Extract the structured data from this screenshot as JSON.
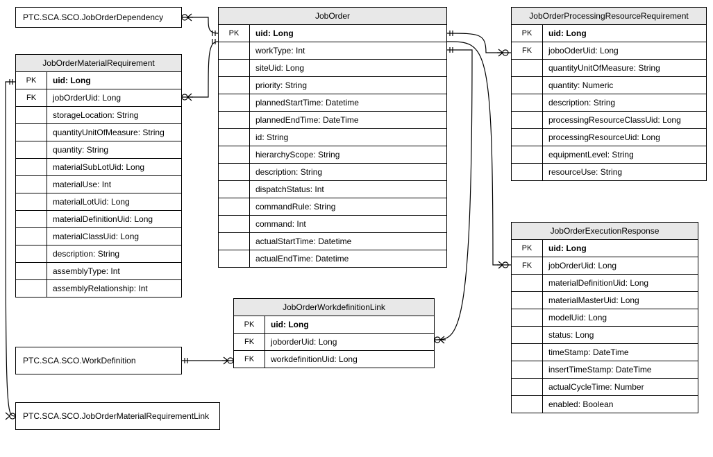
{
  "boxes": {
    "jobOrderDependency": "PTC.SCA.SCO.JobOrderDependency",
    "workDefinition": "PTC.SCA.SCO.WorkDefinition",
    "jobOrderMatReqLink": "PTC.SCA.SCO.JobOrderMaterialRequirementLink"
  },
  "entities": {
    "jobOrder": {
      "title": "JobOrder",
      "rows": [
        {
          "key": "PK",
          "field": "uid: Long",
          "bold": true
        },
        {
          "key": "",
          "field": "workType: Int"
        },
        {
          "key": "",
          "field": "siteUid: Long"
        },
        {
          "key": "",
          "field": "priority: String"
        },
        {
          "key": "",
          "field": "plannedStartTime: Datetime"
        },
        {
          "key": "",
          "field": "plannedEndTime: DateTime"
        },
        {
          "key": "",
          "field": "id: String"
        },
        {
          "key": "",
          "field": "hierarchyScope: String"
        },
        {
          "key": "",
          "field": "description: String"
        },
        {
          "key": "",
          "field": "dispatchStatus: Int"
        },
        {
          "key": "",
          "field": "commandRule: String"
        },
        {
          "key": "",
          "field": "command: Int"
        },
        {
          "key": "",
          "field": "actualStartTime: Datetime"
        },
        {
          "key": "",
          "field": "actualEndTime: Datetime"
        }
      ]
    },
    "matReq": {
      "title": "JobOrderMaterialRequirement",
      "rows": [
        {
          "key": "PK",
          "field": "uid: Long",
          "bold": true
        },
        {
          "key": "FK",
          "field": "jobOrderUid: Long"
        },
        {
          "key": "",
          "field": "storageLocation: String"
        },
        {
          "key": "",
          "field": "quantityUnitOfMeasure: String"
        },
        {
          "key": "",
          "field": "quantity: String"
        },
        {
          "key": "",
          "field": "materialSubLotUid: Long"
        },
        {
          "key": "",
          "field": "materialUse: Int"
        },
        {
          "key": "",
          "field": "materialLotUid: Long"
        },
        {
          "key": "",
          "field": "materialDefinitionUid: Long"
        },
        {
          "key": "",
          "field": "materialClassUid: Long"
        },
        {
          "key": "",
          "field": "description: String"
        },
        {
          "key": "",
          "field": "assemblyType: Int"
        },
        {
          "key": "",
          "field": "assemblyRelationship: Int"
        }
      ]
    },
    "procResReq": {
      "title": "JobOrderProcessingResourceRequirement",
      "rows": [
        {
          "key": "PK",
          "field": "uid: Long",
          "bold": true
        },
        {
          "key": "FK",
          "field": "joboOderUid: Long"
        },
        {
          "key": "",
          "field": "quantityUnitOfMeasure: String"
        },
        {
          "key": "",
          "field": "quantity: Numeric"
        },
        {
          "key": "",
          "field": "description: String"
        },
        {
          "key": "",
          "field": "processingResourceClassUid: Long"
        },
        {
          "key": "",
          "field": "processingResourceUid: Long"
        },
        {
          "key": "",
          "field": "equipmentLevel: String"
        },
        {
          "key": "",
          "field": "resourceUse: String"
        }
      ]
    },
    "execResp": {
      "title": "JobOrderExecutionResponse",
      "rows": [
        {
          "key": "PK",
          "field": "uid: Long",
          "bold": true
        },
        {
          "key": "FK",
          "field": "jobOrderUid: Long"
        },
        {
          "key": "",
          "field": "materialDefinitionUid: Long"
        },
        {
          "key": "",
          "field": "materialMasterUid: Long"
        },
        {
          "key": "",
          "field": "modelUid: Long"
        },
        {
          "key": "",
          "field": "status: Long"
        },
        {
          "key": "",
          "field": "timeStamp: DateTime"
        },
        {
          "key": "",
          "field": "insertTimeStamp: DateTime"
        },
        {
          "key": "",
          "field": "actualCycleTime: Number"
        },
        {
          "key": "",
          "field": "enabled: Boolean"
        }
      ]
    },
    "workDefLink": {
      "title": "JobOrderWorkdefinitionLink",
      "rows": [
        {
          "key": "PK",
          "field": "uid: Long",
          "bold": true
        },
        {
          "key": "FK",
          "field": "joborderUid: Long"
        },
        {
          "key": "FK",
          "field": "workdefinitionUid: Long"
        }
      ]
    }
  },
  "chart_data": {
    "type": "table",
    "diagram_kind": "entity-relationship",
    "entities": [
      {
        "name": "PTC.SCA.SCO.JobOrderDependency",
        "attributes": []
      },
      {
        "name": "JobOrderMaterialRequirement",
        "attributes": [
          {
            "key": "PK",
            "name": "uid",
            "type": "Long"
          },
          {
            "key": "FK",
            "name": "jobOrderUid",
            "type": "Long"
          },
          {
            "name": "storageLocation",
            "type": "String"
          },
          {
            "name": "quantityUnitOfMeasure",
            "type": "String"
          },
          {
            "name": "quantity",
            "type": "String"
          },
          {
            "name": "materialSubLotUid",
            "type": "Long"
          },
          {
            "name": "materialUse",
            "type": "Int"
          },
          {
            "name": "materialLotUid",
            "type": "Long"
          },
          {
            "name": "materialDefinitionUid",
            "type": "Long"
          },
          {
            "name": "materialClassUid",
            "type": "Long"
          },
          {
            "name": "description",
            "type": "String"
          },
          {
            "name": "assemblyType",
            "type": "Int"
          },
          {
            "name": "assemblyRelationship",
            "type": "Int"
          }
        ]
      },
      {
        "name": "JobOrder",
        "attributes": [
          {
            "key": "PK",
            "name": "uid",
            "type": "Long"
          },
          {
            "name": "workType",
            "type": "Int"
          },
          {
            "name": "siteUid",
            "type": "Long"
          },
          {
            "name": "priority",
            "type": "String"
          },
          {
            "name": "plannedStartTime",
            "type": "Datetime"
          },
          {
            "name": "plannedEndTime",
            "type": "DateTime"
          },
          {
            "name": "id",
            "type": "String"
          },
          {
            "name": "hierarchyScope",
            "type": "String"
          },
          {
            "name": "description",
            "type": "String"
          },
          {
            "name": "dispatchStatus",
            "type": "Int"
          },
          {
            "name": "commandRule",
            "type": "String"
          },
          {
            "name": "command",
            "type": "Int"
          },
          {
            "name": "actualStartTime",
            "type": "Datetime"
          },
          {
            "name": "actualEndTime",
            "type": "Datetime"
          }
        ]
      },
      {
        "name": "JobOrderProcessingResourceRequirement",
        "attributes": [
          {
            "key": "PK",
            "name": "uid",
            "type": "Long"
          },
          {
            "key": "FK",
            "name": "joboOderUid",
            "type": "Long"
          },
          {
            "name": "quantityUnitOfMeasure",
            "type": "String"
          },
          {
            "name": "quantity",
            "type": "Numeric"
          },
          {
            "name": "description",
            "type": "String"
          },
          {
            "name": "processingResourceClassUid",
            "type": "Long"
          },
          {
            "name": "processingResourceUid",
            "type": "Long"
          },
          {
            "name": "equipmentLevel",
            "type": "String"
          },
          {
            "name": "resourceUse",
            "type": "String"
          }
        ]
      },
      {
        "name": "JobOrderExecutionResponse",
        "attributes": [
          {
            "key": "PK",
            "name": "uid",
            "type": "Long"
          },
          {
            "key": "FK",
            "name": "jobOrderUid",
            "type": "Long"
          },
          {
            "name": "materialDefinitionUid",
            "type": "Long"
          },
          {
            "name": "materialMasterUid",
            "type": "Long"
          },
          {
            "name": "modelUid",
            "type": "Long"
          },
          {
            "name": "status",
            "type": "Long"
          },
          {
            "name": "timeStamp",
            "type": "DateTime"
          },
          {
            "name": "insertTimeStamp",
            "type": "DateTime"
          },
          {
            "name": "actualCycleTime",
            "type": "Number"
          },
          {
            "name": "enabled",
            "type": "Boolean"
          }
        ]
      },
      {
        "name": "JobOrderWorkdefinitionLink",
        "attributes": [
          {
            "key": "PK",
            "name": "uid",
            "type": "Long"
          },
          {
            "key": "FK",
            "name": "joborderUid",
            "type": "Long"
          },
          {
            "key": "FK",
            "name": "workdefinitionUid",
            "type": "Long"
          }
        ]
      },
      {
        "name": "PTC.SCA.SCO.WorkDefinition",
        "attributes": []
      },
      {
        "name": "PTC.SCA.SCO.JobOrderMaterialRequirementLink",
        "attributes": []
      }
    ],
    "relationships": [
      {
        "from": "PTC.SCA.SCO.JobOrderDependency",
        "to": "JobOrder",
        "from_card": "0..*",
        "to_card": "1"
      },
      {
        "from": "JobOrderMaterialRequirement",
        "to": "JobOrder",
        "from_card": "0..*",
        "to_card": "1"
      },
      {
        "from": "JobOrderProcessingResourceRequirement",
        "to": "JobOrder",
        "from_card": "0..*",
        "to_card": "1"
      },
      {
        "from": "JobOrderExecutionResponse",
        "to": "JobOrder",
        "from_card": "0..*",
        "to_card": "1"
      },
      {
        "from": "JobOrderWorkdefinitionLink",
        "to": "JobOrder",
        "from_card": "0..*",
        "to_card": "1"
      },
      {
        "from": "JobOrderWorkdefinitionLink",
        "to": "PTC.SCA.SCO.WorkDefinition",
        "from_card": "0..*",
        "to_card": "1"
      },
      {
        "from": "PTC.SCA.SCO.JobOrderMaterialRequirementLink",
        "to": "JobOrderMaterialRequirement",
        "from_card": "0..*",
        "to_card": "1"
      }
    ]
  }
}
